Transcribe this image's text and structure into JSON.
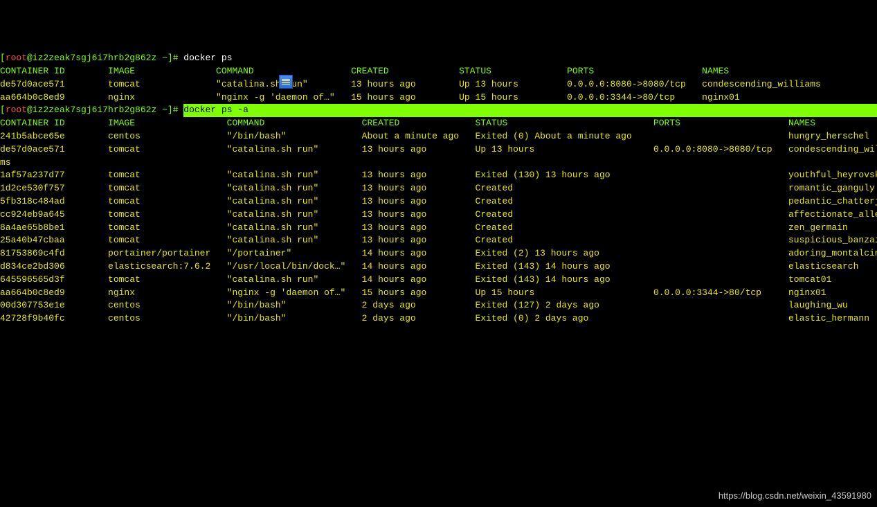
{
  "prompt1": {
    "user": "root",
    "host": "iz2zeak7sgj6i7hrb2g862z",
    "path": "~",
    "cmd": "docker ps"
  },
  "header1": "CONTAINER ID        IMAGE               COMMAND                  CREATED             STATUS              PORTS                    NAMES",
  "ps_rows": [
    "de57d0ace571        tomcat              \"catalina.sh run\"        13 hours ago        Up 13 hours         0.0.0.0:8080->8080/tcp   condescending_williams",
    "aa664b0c8ed9        nginx               \"nginx -g 'daemon of…\"   15 hours ago        Up 15 hours         0.0.0.0:3344->80/tcp     nginx01"
  ],
  "prompt2": {
    "user": "root",
    "host": "iz2zeak7sgj6i7hrb2g862z",
    "path": "~",
    "cmd_hl": "docker ps -a"
  },
  "header2": "CONTAINER ID        IMAGE                 COMMAND                  CREATED              STATUS                           PORTS                    NAMES",
  "psa_rows": [
    "241b5abce65e        centos                \"/bin/bash\"              About a minute ago   Exited (0) About a minute ago                             hungry_herschel",
    "de57d0ace571        tomcat                \"catalina.sh run\"        13 hours ago         Up 13 hours                      0.0.0.0:8080->8080/tcp   condescending_williams",
    "1af57a237d77        tomcat                \"catalina.sh run\"        13 hours ago         Exited (130) 13 hours ago                                 youthful_heyrovsky",
    "1d2ce530f757        tomcat                \"catalina.sh run\"        13 hours ago         Created                                                   romantic_ganguly",
    "5fb318c484ad        tomcat                \"catalina.sh run\"        13 hours ago         Created                                                   pedantic_chatterjee",
    "cc924eb9a645        tomcat                \"catalina.sh run\"        13 hours ago         Created                                                   affectionate_allen",
    "8a4ae65b8be1        tomcat                \"catalina.sh run\"        13 hours ago         Created                                                   zen_germain",
    "25a40b47cbaa        tomcat                \"catalina.sh run\"        13 hours ago         Created                                                   suspicious_banzai",
    "81753869c4fd        portainer/portainer   \"/portainer\"             14 hours ago         Exited (2) 13 hours ago                                   adoring_montalcini",
    "d834ce2bd306        elasticsearch:7.6.2   \"/usr/local/bin/dock…\"   14 hours ago         Exited (143) 14 hours ago                                 elasticsearch",
    "645596565d3f        tomcat                \"catalina.sh run\"        14 hours ago         Exited (143) 14 hours ago                                 tomcat01",
    "aa664b0c8ed9        nginx                 \"nginx -g 'daemon of…\"   15 hours ago         Up 15 hours                      0.0.0.0:3344->80/tcp     nginx01",
    "00d307753e1e        centos                \"/bin/bash\"              2 days ago           Exited (127) 2 days ago                                   laughing_wu",
    "42728f9b40fc        centos                \"/bin/bash\"              2 days ago           Exited (0) 2 days ago                                     elastic_hermann"
  ],
  "watermark": "https://blog.csdn.net/weixin_43591980",
  "wrap_width": 166
}
